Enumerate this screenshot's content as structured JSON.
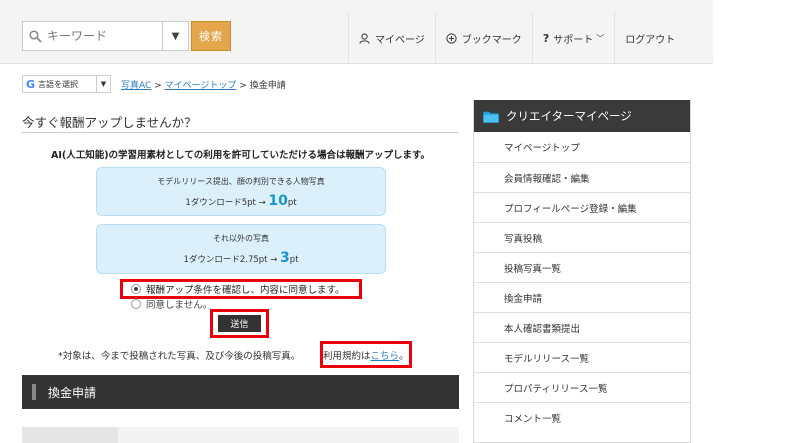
{
  "header": {
    "search_placeholder": "キーワード",
    "search_select": "▼",
    "search_button": "検索",
    "nav": [
      {
        "label": "マイページ",
        "icon": "user-icon"
      },
      {
        "label": "ブックマーク",
        "icon": "plus-circle-icon"
      },
      {
        "label": "サポート",
        "icon": "question-icon"
      },
      {
        "label": "ログアウト",
        "icon": ""
      }
    ]
  },
  "breadcrumb": {
    "translate_label": "言語を選択",
    "translate_caret": "▼",
    "items": [
      "写真AC",
      "マイページトップ",
      "換金申請"
    ],
    "separator": ">"
  },
  "main": {
    "title": "今すぐ報酬アップしませんか？",
    "lead": "AI(人工知能)の学習用素材としての利用を許可していただける場合は報酬アップします。",
    "box1": {
      "line1": "モデルリリース提出、顔の判別できる人物写真",
      "line2_prefix": "1ダウンロード5pt → ",
      "line2_value": "10",
      "line2_unit": "pt"
    },
    "box2": {
      "line1": "それ以外の写真",
      "line2_prefix": "1ダウンロード2.75pt → ",
      "line2_value": "3",
      "line2_unit": "pt"
    },
    "agree_label": "報酬アップ条件を確認し、内容に同意します。",
    "disagree_label": "同意しません。",
    "submit_label": "送信",
    "note": "*対象は、今まで投稿された写真、及び今後の投稿写真。",
    "terms_prefix": "利用規約は",
    "terms_link": "こちら",
    "terms_suffix": "。",
    "section_title": "換金申請"
  },
  "sidebar": {
    "title": "クリエイターマイページ",
    "items": [
      "マイページトップ",
      "会員情報確認・編集",
      "プロフィールページ登録・編集",
      "写真投稿",
      "投稿写真一覧",
      "換金申請",
      "本人確認書類提出",
      "モデルリリース一覧",
      "プロパティリリース一覧",
      "コメント一覧"
    ]
  },
  "colors": {
    "accent_orange": "#e3a64a",
    "link_blue": "#2e7dc1",
    "highlight_red": "#e8000b",
    "info_bg": "#dcf0fb"
  }
}
